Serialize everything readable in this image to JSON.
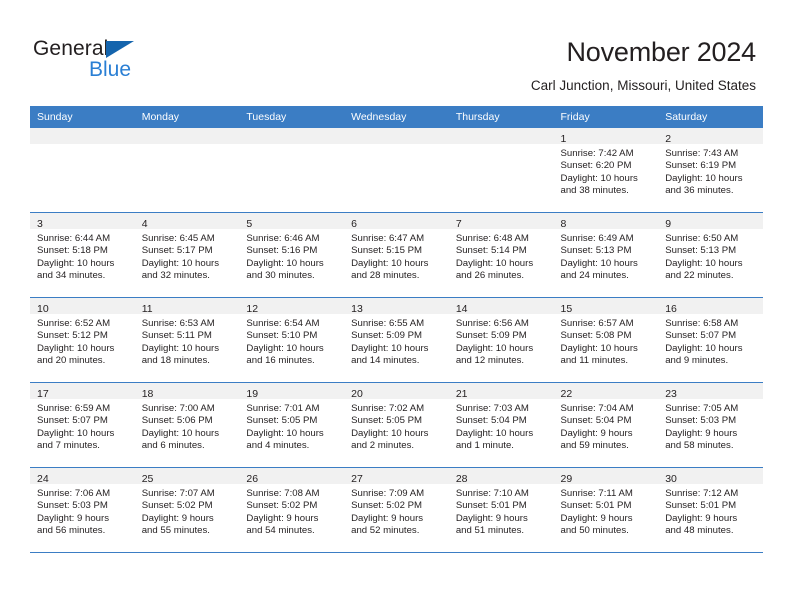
{
  "brand": {
    "name_part1": "General",
    "name_part2": "Blue",
    "triangle_color": "#1464ad",
    "blue_color": "#2a7fd4"
  },
  "header": {
    "title": "November 2024",
    "subtitle": "Carl Junction, Missouri, United States",
    "header_bg": "#3b7dc4",
    "daystrip_bg": "#f1f1f1"
  },
  "weekday_headers": [
    "Sunday",
    "Monday",
    "Tuesday",
    "Wednesday",
    "Thursday",
    "Friday",
    "Saturday"
  ],
  "labels": {
    "sunrise_prefix": "Sunrise:",
    "sunset_prefix": "Sunset:",
    "daylight_prefix": "Daylight:"
  },
  "weeks": [
    [
      {
        "empty": true
      },
      {
        "empty": true
      },
      {
        "empty": true
      },
      {
        "empty": true
      },
      {
        "empty": true
      },
      {
        "day": "1",
        "sunrise": "Sunrise: 7:42 AM",
        "sunset": "Sunset: 6:20 PM",
        "daylight1": "Daylight: 10 hours",
        "daylight2": "and 38 minutes."
      },
      {
        "day": "2",
        "sunrise": "Sunrise: 7:43 AM",
        "sunset": "Sunset: 6:19 PM",
        "daylight1": "Daylight: 10 hours",
        "daylight2": "and 36 minutes."
      }
    ],
    [
      {
        "day": "3",
        "sunrise": "Sunrise: 6:44 AM",
        "sunset": "Sunset: 5:18 PM",
        "daylight1": "Daylight: 10 hours",
        "daylight2": "and 34 minutes."
      },
      {
        "day": "4",
        "sunrise": "Sunrise: 6:45 AM",
        "sunset": "Sunset: 5:17 PM",
        "daylight1": "Daylight: 10 hours",
        "daylight2": "and 32 minutes."
      },
      {
        "day": "5",
        "sunrise": "Sunrise: 6:46 AM",
        "sunset": "Sunset: 5:16 PM",
        "daylight1": "Daylight: 10 hours",
        "daylight2": "and 30 minutes."
      },
      {
        "day": "6",
        "sunrise": "Sunrise: 6:47 AM",
        "sunset": "Sunset: 5:15 PM",
        "daylight1": "Daylight: 10 hours",
        "daylight2": "and 28 minutes."
      },
      {
        "day": "7",
        "sunrise": "Sunrise: 6:48 AM",
        "sunset": "Sunset: 5:14 PM",
        "daylight1": "Daylight: 10 hours",
        "daylight2": "and 26 minutes."
      },
      {
        "day": "8",
        "sunrise": "Sunrise: 6:49 AM",
        "sunset": "Sunset: 5:13 PM",
        "daylight1": "Daylight: 10 hours",
        "daylight2": "and 24 minutes."
      },
      {
        "day": "9",
        "sunrise": "Sunrise: 6:50 AM",
        "sunset": "Sunset: 5:13 PM",
        "daylight1": "Daylight: 10 hours",
        "daylight2": "and 22 minutes."
      }
    ],
    [
      {
        "day": "10",
        "sunrise": "Sunrise: 6:52 AM",
        "sunset": "Sunset: 5:12 PM",
        "daylight1": "Daylight: 10 hours",
        "daylight2": "and 20 minutes."
      },
      {
        "day": "11",
        "sunrise": "Sunrise: 6:53 AM",
        "sunset": "Sunset: 5:11 PM",
        "daylight1": "Daylight: 10 hours",
        "daylight2": "and 18 minutes."
      },
      {
        "day": "12",
        "sunrise": "Sunrise: 6:54 AM",
        "sunset": "Sunset: 5:10 PM",
        "daylight1": "Daylight: 10 hours",
        "daylight2": "and 16 minutes."
      },
      {
        "day": "13",
        "sunrise": "Sunrise: 6:55 AM",
        "sunset": "Sunset: 5:09 PM",
        "daylight1": "Daylight: 10 hours",
        "daylight2": "and 14 minutes."
      },
      {
        "day": "14",
        "sunrise": "Sunrise: 6:56 AM",
        "sunset": "Sunset: 5:09 PM",
        "daylight1": "Daylight: 10 hours",
        "daylight2": "and 12 minutes."
      },
      {
        "day": "15",
        "sunrise": "Sunrise: 6:57 AM",
        "sunset": "Sunset: 5:08 PM",
        "daylight1": "Daylight: 10 hours",
        "daylight2": "and 11 minutes."
      },
      {
        "day": "16",
        "sunrise": "Sunrise: 6:58 AM",
        "sunset": "Sunset: 5:07 PM",
        "daylight1": "Daylight: 10 hours",
        "daylight2": "and 9 minutes."
      }
    ],
    [
      {
        "day": "17",
        "sunrise": "Sunrise: 6:59 AM",
        "sunset": "Sunset: 5:07 PM",
        "daylight1": "Daylight: 10 hours",
        "daylight2": "and 7 minutes."
      },
      {
        "day": "18",
        "sunrise": "Sunrise: 7:00 AM",
        "sunset": "Sunset: 5:06 PM",
        "daylight1": "Daylight: 10 hours",
        "daylight2": "and 6 minutes."
      },
      {
        "day": "19",
        "sunrise": "Sunrise: 7:01 AM",
        "sunset": "Sunset: 5:05 PM",
        "daylight1": "Daylight: 10 hours",
        "daylight2": "and 4 minutes."
      },
      {
        "day": "20",
        "sunrise": "Sunrise: 7:02 AM",
        "sunset": "Sunset: 5:05 PM",
        "daylight1": "Daylight: 10 hours",
        "daylight2": "and 2 minutes."
      },
      {
        "day": "21",
        "sunrise": "Sunrise: 7:03 AM",
        "sunset": "Sunset: 5:04 PM",
        "daylight1": "Daylight: 10 hours",
        "daylight2": "and 1 minute."
      },
      {
        "day": "22",
        "sunrise": "Sunrise: 7:04 AM",
        "sunset": "Sunset: 5:04 PM",
        "daylight1": "Daylight: 9 hours",
        "daylight2": "and 59 minutes."
      },
      {
        "day": "23",
        "sunrise": "Sunrise: 7:05 AM",
        "sunset": "Sunset: 5:03 PM",
        "daylight1": "Daylight: 9 hours",
        "daylight2": "and 58 minutes."
      }
    ],
    [
      {
        "day": "24",
        "sunrise": "Sunrise: 7:06 AM",
        "sunset": "Sunset: 5:03 PM",
        "daylight1": "Daylight: 9 hours",
        "daylight2": "and 56 minutes."
      },
      {
        "day": "25",
        "sunrise": "Sunrise: 7:07 AM",
        "sunset": "Sunset: 5:02 PM",
        "daylight1": "Daylight: 9 hours",
        "daylight2": "and 55 minutes."
      },
      {
        "day": "26",
        "sunrise": "Sunrise: 7:08 AM",
        "sunset": "Sunset: 5:02 PM",
        "daylight1": "Daylight: 9 hours",
        "daylight2": "and 54 minutes."
      },
      {
        "day": "27",
        "sunrise": "Sunrise: 7:09 AM",
        "sunset": "Sunset: 5:02 PM",
        "daylight1": "Daylight: 9 hours",
        "daylight2": "and 52 minutes."
      },
      {
        "day": "28",
        "sunrise": "Sunrise: 7:10 AM",
        "sunset": "Sunset: 5:01 PM",
        "daylight1": "Daylight: 9 hours",
        "daylight2": "and 51 minutes."
      },
      {
        "day": "29",
        "sunrise": "Sunrise: 7:11 AM",
        "sunset": "Sunset: 5:01 PM",
        "daylight1": "Daylight: 9 hours",
        "daylight2": "and 50 minutes."
      },
      {
        "day": "30",
        "sunrise": "Sunrise: 7:12 AM",
        "sunset": "Sunset: 5:01 PM",
        "daylight1": "Daylight: 9 hours",
        "daylight2": "and 48 minutes."
      }
    ]
  ]
}
